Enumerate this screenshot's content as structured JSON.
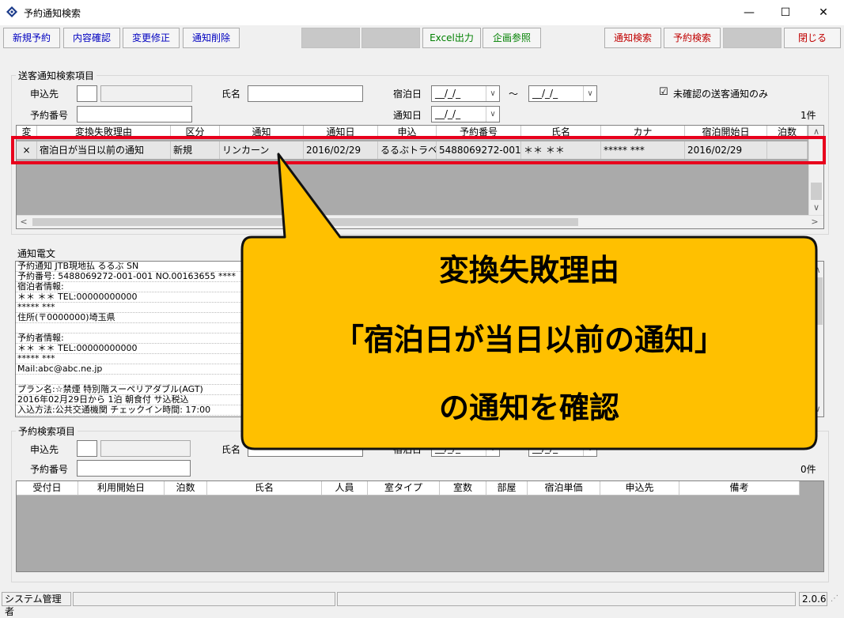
{
  "window": {
    "title": "予約通知検索",
    "minimize": "—",
    "maximize": "☐",
    "close": "✕"
  },
  "toolbar": {
    "new_reservation": "新規予約",
    "view_details": "内容確認",
    "modify": "変更修正",
    "delete_notice": "通知削除",
    "excel_export": "Excel出力",
    "plan_reference": "企画参照",
    "notice_search": "通知検索",
    "reservation_search": "予約検索",
    "close": "閉じる"
  },
  "notice_search": {
    "group_label": "送客通知検索項目",
    "applicant_label": "申込先",
    "name_label": "氏名",
    "stay_date_label": "宿泊日",
    "stay_date_from": "__/_/_",
    "tilde": "～",
    "stay_date_to": "__/_/_",
    "reservation_no_label": "予約番号",
    "notice_date_label": "通知日",
    "notice_date": "__/_/_",
    "unconfirmed_only_label": "未確認の送客通知のみ",
    "unconfirmed_only_checked": "☑",
    "count": "1件"
  },
  "notice_grid": {
    "columns": [
      "変",
      "変換失敗理由",
      "区分",
      "通知",
      "通知日",
      "申込",
      "予約番号",
      "氏名",
      "カナ",
      "宿泊開始日",
      "泊数"
    ],
    "rows": [
      {
        "mark": "×",
        "reason": "宿泊日が当日以前の通知",
        "category": "新規",
        "notice": "リンカーン",
        "notice_date": "2016/02/29",
        "applicant": "るるぶトラベル",
        "reservation_no": "5488069272-001…",
        "name": "＊＊ ＊＊",
        "kana": "***** ***",
        "stay_start": "2016/02/29",
        "nights": ""
      }
    ]
  },
  "message_panel": {
    "label": "通知電文",
    "lines": [
      "予約通知 JTB現地払 るるぶ                    SN",
      "予約番号: 5488069272-001-001  NO.00163655  ****",
      "宿泊者情報:",
      "  ＊＊ ＊＊   TEL:00000000000",
      " ***** ***",
      " 住所(〒0000000)埼玉県",
      "",
      "予約者情報:",
      "  ＊＊ ＊＊   TEL:00000000000",
      " ***** ***",
      " Mail:abc@abc.ne.jp",
      "",
      "プラン名:☆禁煙  特別階スーペリアダブル(AGT)",
      "2016年02月29日から   1泊  朝食付  サ込税込",
      "入込方法:公共交通機関      チェックイン時間: 17:00"
    ]
  },
  "reservation_search": {
    "group_label": "予約検索項目",
    "applicant_label": "申込先",
    "name_label": "氏名",
    "stay_date_label": "宿泊日",
    "stay_date_from": "__/_/_",
    "stay_date_to": "__/_/_",
    "reservation_no_label": "予約番号",
    "count": "0件"
  },
  "reservation_grid": {
    "columns": [
      "受付日",
      "利用開始日",
      "泊数",
      "氏名",
      "人員",
      "室タイプ",
      "室数",
      "部屋",
      "宿泊単価",
      "申込先",
      "備考"
    ]
  },
  "status_bar": {
    "user": "システム管理者",
    "version": "2.0.6"
  },
  "callout": {
    "line1": "変換失敗理由",
    "line2": "「宿泊日が当日以前の通知」",
    "line3": "の通知を確認",
    "fill_color": "#ffc000",
    "highlight_color": "#e8001c"
  }
}
